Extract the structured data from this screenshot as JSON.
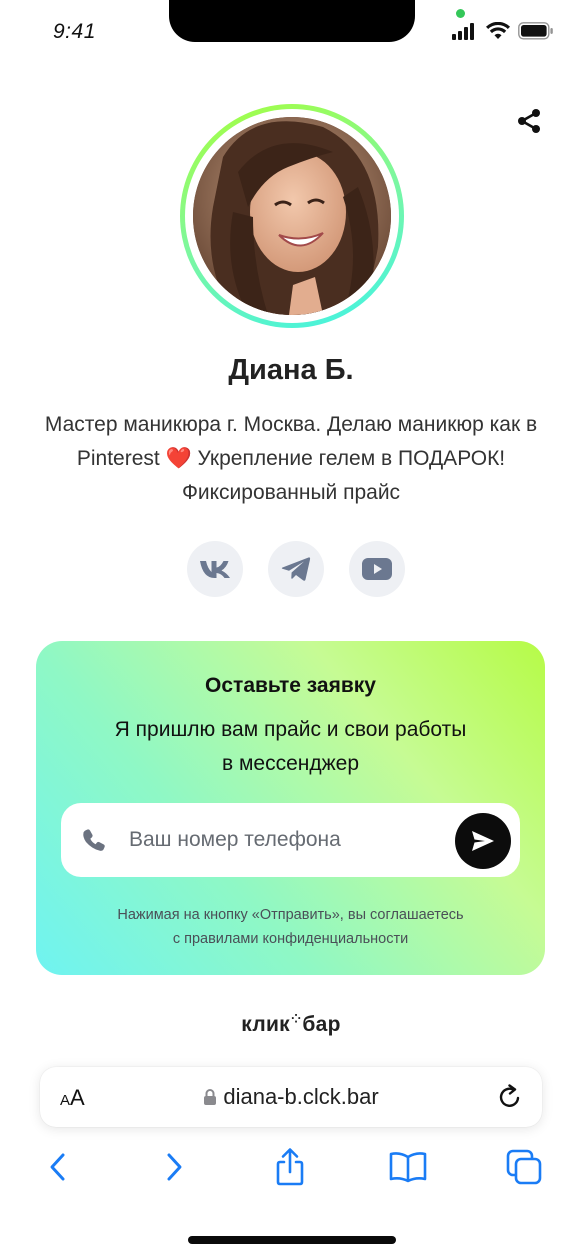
{
  "status": {
    "time": "9:41"
  },
  "profile": {
    "name": "Диана Б.",
    "bio": "Мастер маникюра г. Москва. Делаю маникюр как в Pinterest ❤️ Укрепление гелем в ПОДАРОК! Фиксированный прайс",
    "socials": [
      {
        "icon": "vk-icon"
      },
      {
        "icon": "telegram-icon"
      },
      {
        "icon": "youtube-icon"
      }
    ]
  },
  "form": {
    "title": "Оставьте заявку",
    "subtitle_line1": "Я пришлю вам прайс и свои работы",
    "subtitle_line2": "в мессенджер",
    "phone_placeholder": "Ваш номер телефона",
    "consent_line1": "Нажимая на кнопку «Отправить», вы соглашаетесь",
    "consent_line2": "с правилами конфиденциальности"
  },
  "brand": {
    "part1": "клик",
    "part2": "бар"
  },
  "browser": {
    "aa_small": "A",
    "aa_large": "A",
    "url": "diana-b.clck.bar"
  },
  "colors": {
    "accent_dark": "#0c0c0c",
    "gradient_start": "#6ff3f1",
    "gradient_end": "#b6fb47",
    "ios_blue": "#1a7cf5"
  }
}
